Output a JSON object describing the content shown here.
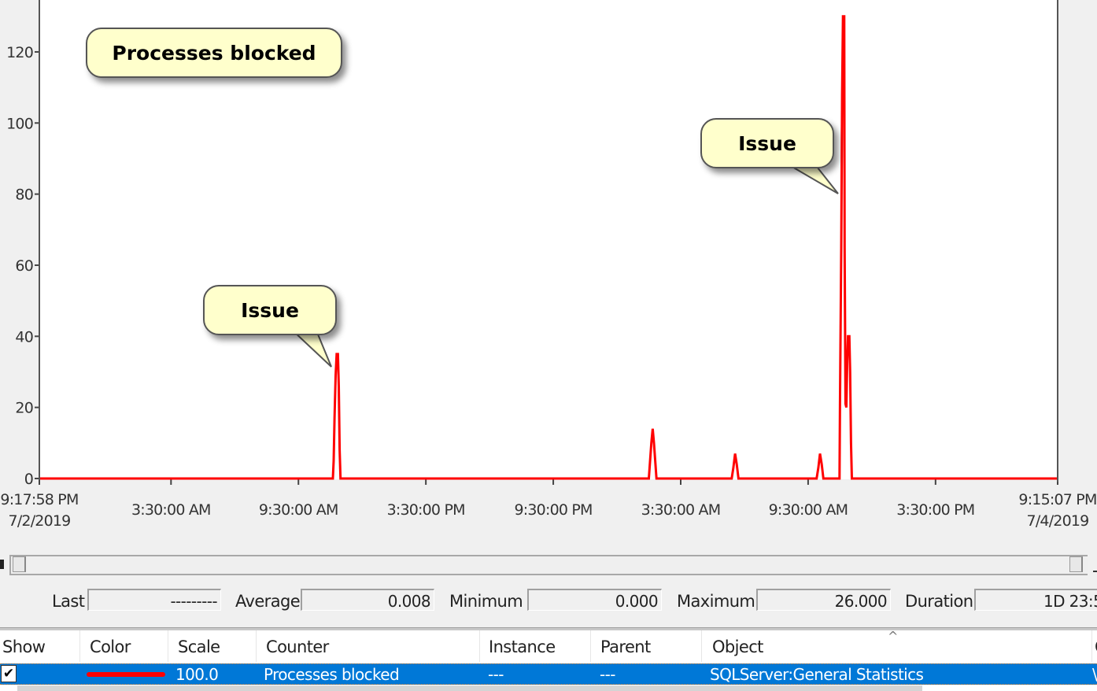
{
  "chart_data": {
    "type": "line",
    "title": "Processes blocked",
    "xlabel": "",
    "ylabel": "",
    "x_units": "hours since 9:17:58 PM 7/2/2019",
    "xlim": [
      0,
      47.95
    ],
    "ylim": [
      0,
      130
    ],
    "y_ticks": [
      0,
      20,
      40,
      60,
      80,
      100,
      120
    ],
    "x_ticks": [
      {
        "hours": 0,
        "label": [
          "9:17:58 PM",
          "7/2/2019"
        ]
      },
      {
        "hours": 6.2,
        "label": [
          "3:30:00 AM"
        ]
      },
      {
        "hours": 12.2,
        "label": [
          "9:30:00 AM"
        ]
      },
      {
        "hours": 18.2,
        "label": [
          "3:30:00 PM"
        ]
      },
      {
        "hours": 24.2,
        "label": [
          "9:30:00 PM"
        ]
      },
      {
        "hours": 30.2,
        "label": [
          "3:30:00 AM"
        ]
      },
      {
        "hours": 36.2,
        "label": [
          "9:30:00 AM"
        ]
      },
      {
        "hours": 42.2,
        "label": [
          "3:30:00 PM"
        ]
      },
      {
        "hours": 47.95,
        "label": [
          "9:15:07 PM",
          "7/4/2019"
        ]
      }
    ],
    "grid": false,
    "series": [
      {
        "name": "Processes blocked",
        "color": "#ff0000",
        "points": [
          [
            0,
            0
          ],
          [
            13.82,
            0
          ],
          [
            13.86,
            5
          ],
          [
            13.9,
            17
          ],
          [
            13.95,
            29
          ],
          [
            14.0,
            35
          ],
          [
            14.06,
            35
          ],
          [
            14.1,
            26
          ],
          [
            14.14,
            8
          ],
          [
            14.18,
            0
          ],
          [
            28.7,
            0
          ],
          [
            28.76,
            5
          ],
          [
            28.82,
            10
          ],
          [
            28.88,
            14
          ],
          [
            28.94,
            10
          ],
          [
            29.0,
            5
          ],
          [
            29.06,
            0
          ],
          [
            32.6,
            0
          ],
          [
            32.68,
            3
          ],
          [
            32.76,
            7
          ],
          [
            32.84,
            4
          ],
          [
            32.92,
            0
          ],
          [
            36.6,
            0
          ],
          [
            36.68,
            3
          ],
          [
            36.76,
            7
          ],
          [
            36.84,
            4
          ],
          [
            36.92,
            0
          ],
          [
            37.68,
            0
          ],
          [
            37.7,
            21
          ],
          [
            37.76,
            65
          ],
          [
            37.8,
            108
          ],
          [
            37.84,
            130
          ],
          [
            37.9,
            130
          ],
          [
            37.92,
            65
          ],
          [
            37.96,
            21
          ],
          [
            38.0,
            20
          ],
          [
            38.04,
            33
          ],
          [
            38.08,
            40
          ],
          [
            38.14,
            40
          ],
          [
            38.18,
            30
          ],
          [
            38.22,
            10
          ],
          [
            38.26,
            0
          ],
          [
            47.95,
            0
          ]
        ]
      }
    ],
    "annotations": [
      {
        "text": "Processes blocked",
        "kind": "title-callout"
      },
      {
        "text": "Issue",
        "points_to_hours": 13.95,
        "points_to_value": 29
      },
      {
        "text": "Issue",
        "points_to_hours": 37.7,
        "points_to_value": 80
      }
    ]
  },
  "scrollbar": {
    "name": "time-range-scrollbar"
  },
  "stats": {
    "last_label": "Last",
    "last_value": "---------",
    "average_label": "Average",
    "average_value": "0.008",
    "minimum_label": "Minimum",
    "minimum_value": "0.000",
    "maximum_label": "Maximum",
    "maximum_value": "26.000",
    "duration_label": "Duration",
    "duration_value": "1D 23:5"
  },
  "table": {
    "columns": [
      "Show",
      "Color",
      "Scale",
      "Counter",
      "Instance",
      "Parent",
      "Object",
      "C"
    ],
    "rows": [
      {
        "show": "✔",
        "color": "#ff0000",
        "scale": "100.0",
        "counter": "Processes blocked",
        "instance": "---",
        "parent": "---",
        "object": "SQLServer:General Statistics",
        "computer": "\\"
      }
    ],
    "sort_indicator": "^"
  }
}
